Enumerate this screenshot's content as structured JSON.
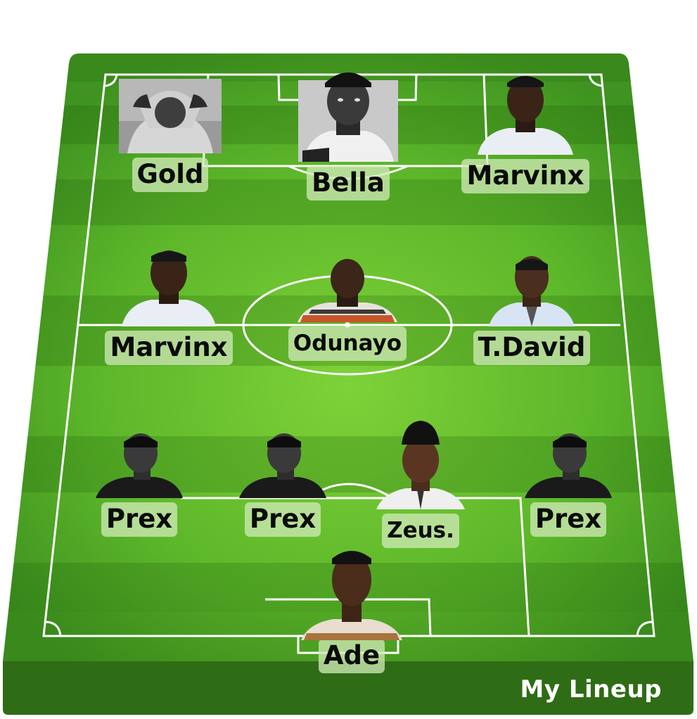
{
  "lineup": {
    "title": "My Lineup",
    "players": [
      {
        "id": "p1",
        "name": "Gold",
        "portrait": "person-hoodie-bw-icon"
      },
      {
        "id": "p2",
        "name": "Bella",
        "portrait": "person-cap-bw-icon"
      },
      {
        "id": "p3",
        "name": "Marvinx",
        "portrait": "person-white-tee-icon"
      },
      {
        "id": "p4",
        "name": "Marvinx",
        "portrait": "person-white-tee-icon"
      },
      {
        "id": "p5",
        "name": "Odunayo",
        "portrait": "person-pattern-shirt-icon"
      },
      {
        "id": "p6",
        "name": "T.David",
        "portrait": "person-blue-shirt-icon"
      },
      {
        "id": "p7",
        "name": "Prex",
        "portrait": "person-bw-icon"
      },
      {
        "id": "p8",
        "name": "Prex",
        "portrait": "person-bw-icon"
      },
      {
        "id": "p9",
        "name": "Zeus.",
        "portrait": "person-cap-white-shirt-icon"
      },
      {
        "id": "p10",
        "name": "Prex",
        "portrait": "person-bw-icon"
      },
      {
        "id": "p11",
        "name": "Ade",
        "portrait": "person-pattern-shirt-icon"
      }
    ]
  },
  "colors": {
    "pitch_light": "#6cc52c",
    "pitch_dark": "#3f9a1b",
    "pitch_shadow": "#2f6c16",
    "lines": "#ffffff",
    "name_tag_bg": "#cde8b4"
  }
}
